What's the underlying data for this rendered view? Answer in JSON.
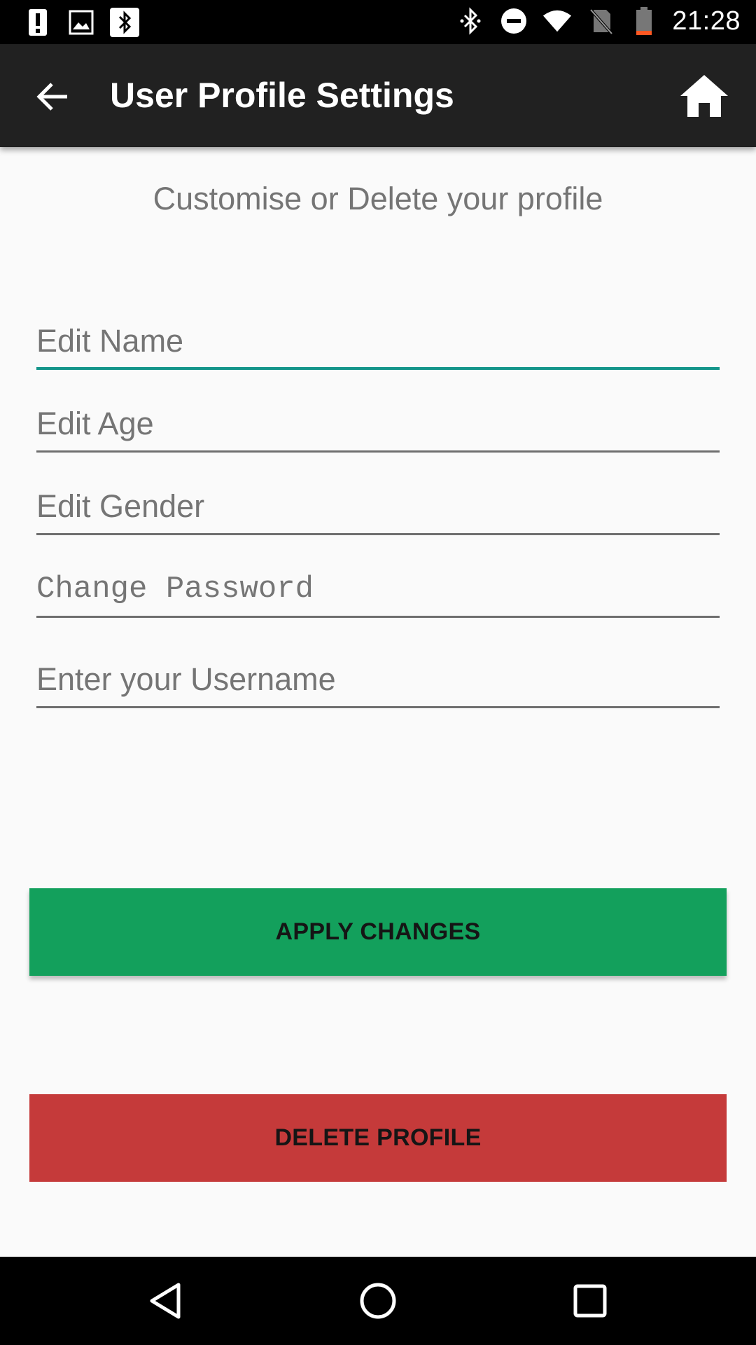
{
  "status_bar": {
    "time": "21:28",
    "left_icons": [
      "alert-icon",
      "image-icon",
      "bluetooth-icon"
    ],
    "right_icons": [
      "bluetooth-icon",
      "do-not-disturb-icon",
      "wifi-icon",
      "no-sim-icon",
      "battery-low-icon"
    ]
  },
  "app_bar": {
    "title": "User Profile Settings",
    "back_icon": "arrow-back-icon",
    "home_icon": "home-icon"
  },
  "subtitle": "Customise or Delete your profile",
  "form": {
    "name_placeholder": "Edit Name",
    "age_placeholder": "Edit Age",
    "gender_placeholder": "Edit Gender",
    "password_placeholder": "Change Password",
    "username_placeholder": "Enter your Username"
  },
  "buttons": {
    "apply_label": "APPLY CHANGES",
    "delete_label": "DELETE PROFILE"
  },
  "colors": {
    "app_bar": "#212121",
    "accent_underline": "#14958a",
    "apply": "#13a05c",
    "delete": "#c53a3a",
    "battery_low": "#ff5722"
  },
  "nav_bar": {
    "icons": [
      "nav-back-icon",
      "nav-home-icon",
      "nav-recents-icon"
    ]
  }
}
